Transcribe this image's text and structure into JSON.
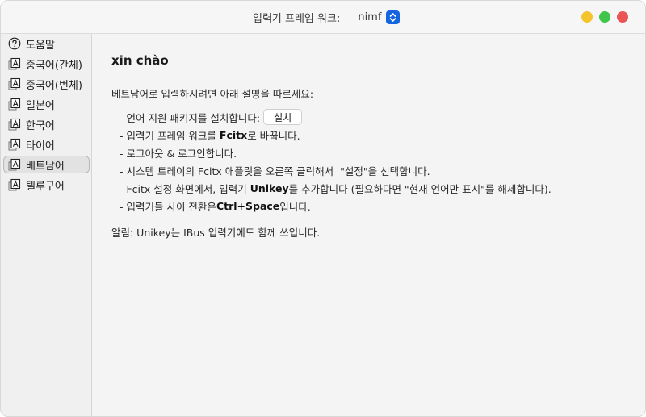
{
  "titlebar": {
    "label": "입력기 프레임 워크:",
    "framework_value": "nimf",
    "colors": {
      "minimize": "#f5c32c",
      "maximize": "#3ec54a",
      "close": "#ec5354",
      "select_accent": "#1565e0"
    }
  },
  "sidebar": {
    "items": [
      {
        "label": "도움말",
        "icon": "help-circle-icon",
        "selected": false
      },
      {
        "label": "중국어(간체)",
        "icon": "input-method-a-icon",
        "selected": false
      },
      {
        "label": "중국어(번체)",
        "icon": "input-method-a-icon",
        "selected": false
      },
      {
        "label": "일본어",
        "icon": "input-method-a-icon",
        "selected": false
      },
      {
        "label": "한국어",
        "icon": "input-method-a-icon",
        "selected": false
      },
      {
        "label": "타이어",
        "icon": "input-method-a-icon",
        "selected": false
      },
      {
        "label": "베트남어",
        "icon": "input-method-a-icon",
        "selected": true
      },
      {
        "label": "텔루구어",
        "icon": "input-method-a-icon",
        "selected": false
      }
    ]
  },
  "main": {
    "heading": "xin chào",
    "intro": "베트남어로 입력하시려면 아래 설명을 따르세요:",
    "steps": {
      "s1_text": "- 언어 지원 패키지를 설치합니다:",
      "install_label": "설치",
      "s2_pre": "- 입력기 프레임 워크를 ",
      "s2_bold": "Fcitx",
      "s2_post": "로 바꿉니다.",
      "s3_text": "- 로그아웃 & 로그인합니다.",
      "s4_text": "- 시스템 트레이의 Fcitx 애플릿을 오른쪽 클릭해서  \"설정\"을 선택합니다.",
      "s5_pre": "- Fcitx 설정 화면에서, 입력기 ",
      "s5_bold": "Unikey",
      "s5_post": "를 추가합니다 (필요하다면 \"현재 언어만 표시\"를 해제합니다).",
      "s6_pre": "- 입력기들 사이 전환은",
      "s6_bold": "Ctrl+Space",
      "s6_post": "입니다."
    },
    "note": "알림: Unikey는 IBus 입력기에도 함께 쓰입니다."
  }
}
